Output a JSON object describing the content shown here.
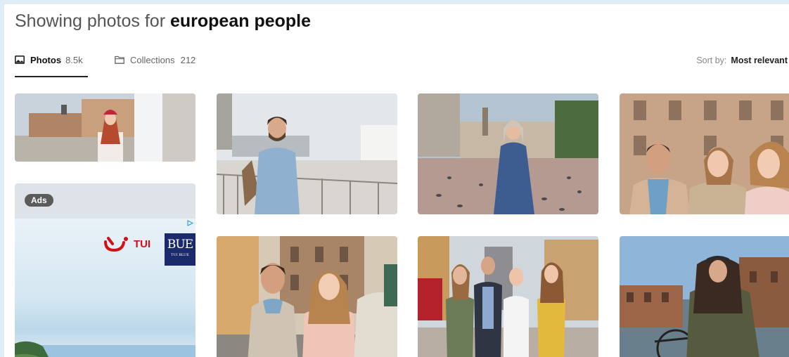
{
  "heading": {
    "prefix": "Showing photos for",
    "query": "european people"
  },
  "tabs": [
    {
      "label": "Photos",
      "count": "8.5k",
      "icon": "image-icon",
      "active": true
    },
    {
      "label": "Collections",
      "count": "212",
      "icon": "folder-icon",
      "active": false
    }
  ],
  "sort": {
    "label": "Sort by:",
    "value": "Most relevant"
  },
  "ad": {
    "badge": "Ads",
    "brand": "TUI",
    "brand2": "BUE",
    "brand2_sub": "TUI BLUE"
  },
  "colors": {
    "accent": "#222222",
    "tui_red": "#d40e14",
    "tui_blue": "#1b2a6b"
  },
  "photos": [
    {
      "name": "photo-woman-red-hat-square"
    },
    {
      "name": "photo-man-backpack-rooftop"
    },
    {
      "name": "photo-woman-blue-dress-pigeons"
    },
    {
      "name": "photo-three-friends-smiling"
    },
    {
      "name": "photo-friends-walking-street"
    },
    {
      "name": "photo-four-friends-old-town"
    },
    {
      "name": "photo-woman-bicycle-canal"
    }
  ]
}
